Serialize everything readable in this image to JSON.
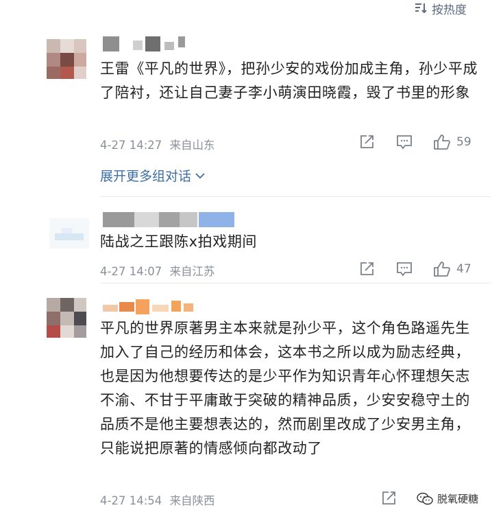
{
  "sort": {
    "label": "按热度",
    "icon": "sort-icon"
  },
  "comments": [
    {
      "text": "王雷《平凡的世界》，把孙少安的戏份加成主角，孙少平成了陪衬，还让自己妻子李小萌演田晓霞，毁了书里的形象",
      "time": "4-27 14:27",
      "location": "来自山东",
      "likes": "59",
      "expand_label": "展开更多组对话"
    },
    {
      "text": "陆战之王跟陈x拍戏期间",
      "time": "4-27 14:07",
      "location": "来自江苏",
      "likes": "47"
    },
    {
      "text": "平凡的世界原著男主本来就是孙少平，这个角色路遥先生加入了自己的经历和体会，这本书之所以成为励志经典，也是因为他想要传达的是少平作为知识青年心怀理想矢志不渝、不甘于平庸敢于突破的精神品质，少安安稳守土的品质不是他主要想表达的，然而剧里改成了少安男主角，只能说把原著的情感倾向都改动了",
      "time": "4-27 14:54",
      "location": "来自陕西"
    }
  ],
  "watermark": {
    "text": "脱氧硬糖",
    "icon": "wechat-icon"
  },
  "colors": {
    "link": "#3b6ea8",
    "meta": "#8a8f99",
    "text": "#222222"
  }
}
